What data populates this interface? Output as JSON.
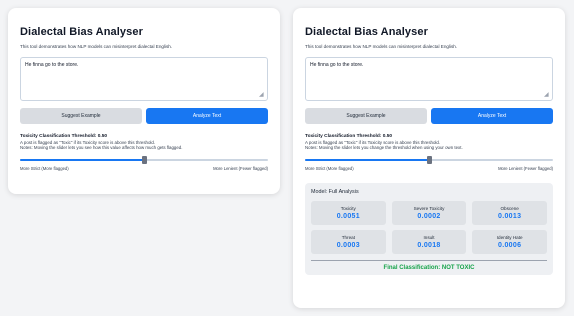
{
  "left_panel": {
    "title": "Dialectal Bias Analyser",
    "description": "This tool demonstrates how NLP models can misinterpret dialectal English.",
    "input_text": "He finna go to the store.",
    "suggest_button": "Suggest Example",
    "analyze_button": "Analyze Text",
    "threshold_label": "Toxicity Classification Threshold: 0.50",
    "threshold_note_1": "A post is flagged as \"Toxic\" if its Toxicity score is above this threshold.",
    "threshold_note_2": "Notes: Moving the slider lets you see how this value affects how much gets flagged.",
    "threshold_value": 0.5,
    "slider_left_label": "More Strict (More flagged)",
    "slider_right_label": "More Lenient (Fewer flagged)"
  },
  "right_panel": {
    "title": "Dialectal Bias Analyser",
    "description": "This tool demonstrates how NLP models can misinterpret dialectal English.",
    "input_text": "He finna go to the store.",
    "suggest_button": "Suggest Example",
    "analyze_button": "Analyze Text",
    "threshold_label": "Toxicity Classification Threshold: 0.50",
    "threshold_note_1": "A post is flagged as \"Toxic\" if its Toxicity score is above this threshold.",
    "threshold_note_2": "Notes: Moving the slider lets you change the threshold when using your own text.",
    "threshold_value": 0.5,
    "slider_left_label": "More Strict (More flagged)",
    "slider_right_label": "More Lenient (Fewer flagged)",
    "analysis_title": "Model: Full Analysis",
    "metrics": [
      {
        "name": "Toxicity",
        "value": "0.0051"
      },
      {
        "name": "Severe Toxicity",
        "value": "0.0002"
      },
      {
        "name": "Obscene",
        "value": "0.0013"
      },
      {
        "name": "Threat",
        "value": "0.0003"
      },
      {
        "name": "Insult",
        "value": "0.0018"
      },
      {
        "name": "Identity Hate",
        "value": "0.0006"
      }
    ],
    "final_classification": "Final Classification: NOT TOXIC"
  },
  "colors": {
    "accent": "#1877f2",
    "secondary_button": "#d9dce1",
    "success": "#16a34a"
  }
}
